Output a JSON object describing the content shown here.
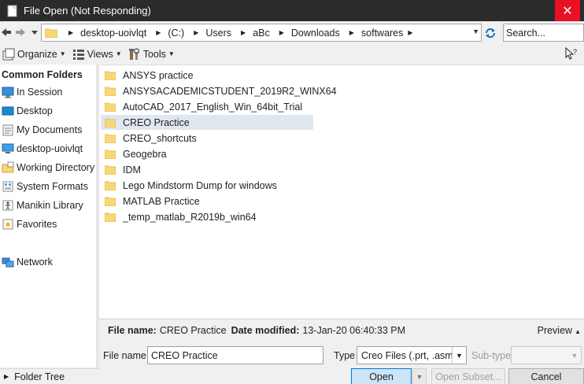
{
  "window": {
    "title": "File Open (Not Responding)",
    "close_symbol": "✕"
  },
  "address": {
    "crumbs": [
      "desktop-uoivlqt",
      "(C:)",
      "Users",
      "aBc",
      "Downloads",
      "softwares"
    ],
    "search_placeholder": "Search..."
  },
  "toolbar": {
    "organize": "Organize",
    "views": "Views",
    "tools": "Tools"
  },
  "sidebar": {
    "title": "Common Folders",
    "items": [
      "In Session",
      "Desktop",
      "My Documents",
      "desktop-uoivlqt",
      "Working Directory",
      "System Formats",
      "Manikin Library",
      "Favorites",
      "Network"
    ],
    "folder_tree": "Folder Tree"
  },
  "files": [
    "ANSYS practice",
    "ANSYSACADEMICSTUDENT_2019R2_WINX64",
    "AutoCAD_2017_English_Win_64bit_Trial",
    "CREO Practice",
    "CREO_shortcuts",
    "Geogebra",
    "IDM",
    "Lego Mindstorm Dump for windows",
    "MATLAB Practice",
    "_temp_matlab_R2019b_win64"
  ],
  "selected_file": "CREO Practice",
  "details": {
    "file_name_label": "File name:",
    "file_name": "CREO Practice",
    "date_label": "Date modified:",
    "date": "13-Jan-20 06:40:33 PM",
    "preview": "Preview"
  },
  "form": {
    "file_name_label": "File name:",
    "file_name_value": "CREO Practice",
    "type_label": "Type",
    "type_value": "Creo Files (.prt, .asm,",
    "subtype_label": "Sub-type"
  },
  "buttons": {
    "open": "Open",
    "open_subset": "Open Subset...",
    "cancel": "Cancel"
  },
  "colors": {
    "titlebar": "#2b2b2b",
    "close": "#e81123",
    "selection": "#dfe7ef",
    "folder": "#f8d775"
  }
}
